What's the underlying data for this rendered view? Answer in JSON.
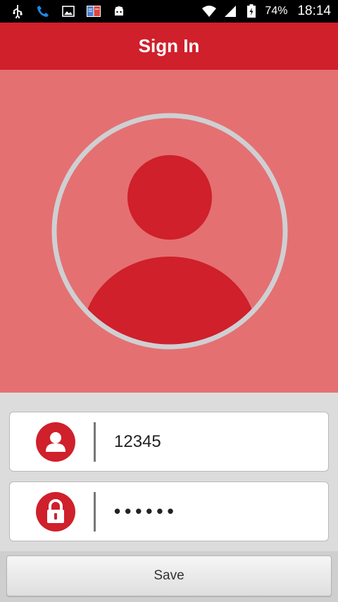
{
  "status_bar": {
    "battery": "74%",
    "time": "18:14",
    "icons": [
      "usb-icon",
      "phone-icon",
      "image-icon",
      "book-icon",
      "android-icon",
      "wifi-icon",
      "signal-icon",
      "battery-icon"
    ]
  },
  "app_bar": {
    "title": "Sign In"
  },
  "avatar": {
    "icon": "user-avatar-icon"
  },
  "form": {
    "username": {
      "value": "12345",
      "icon": "user-icon"
    },
    "password": {
      "value": "••••••",
      "icon": "lock-icon"
    }
  },
  "actions": {
    "save_label": "Save"
  },
  "colors": {
    "primary_red": "#cf202b",
    "hero_bg": "#e47072",
    "form_bg": "#dcdcdc"
  }
}
